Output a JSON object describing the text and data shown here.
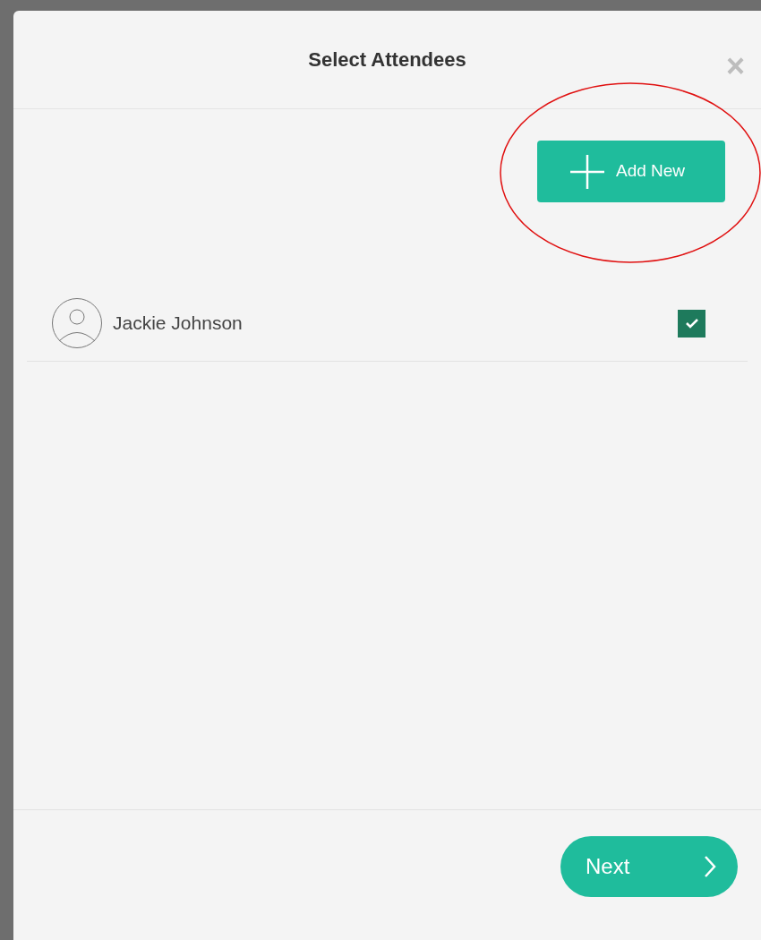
{
  "dialog": {
    "title": "Select Attendees",
    "close": "×"
  },
  "add_button": {
    "label": "Add New",
    "highlighted": true
  },
  "attendees": [
    {
      "name": "Jackie Johnson",
      "checked": true
    }
  ],
  "footer": {
    "next_label": "Next"
  }
}
